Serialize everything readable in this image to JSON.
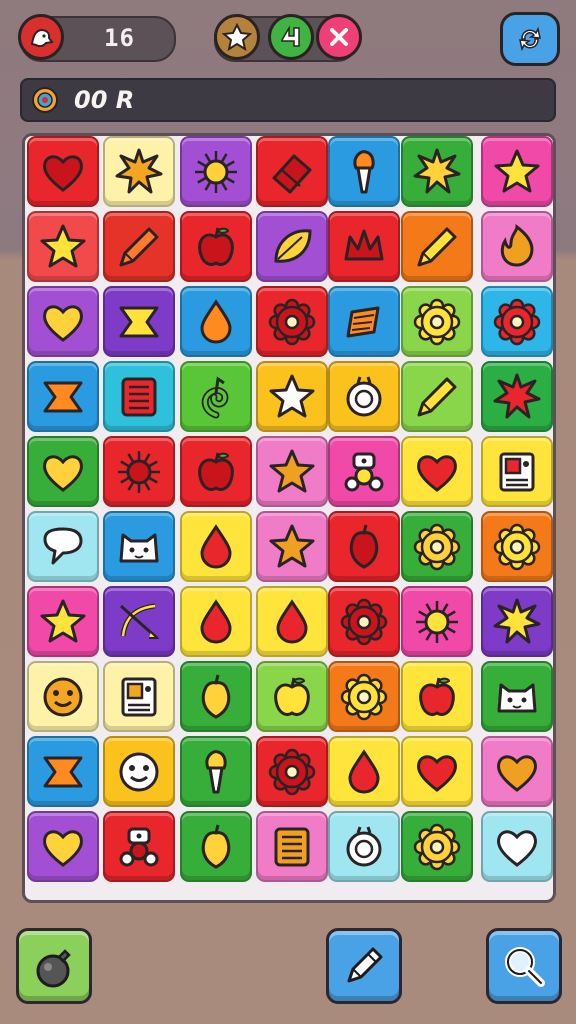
{
  "hud": {
    "score": "16",
    "info_text": "00 R",
    "icons": [
      "level-badge-icon",
      "star-coin-icon",
      "boost-icon",
      "close-icon",
      "refresh-icon"
    ]
  },
  "board": {
    "cols": 7,
    "rows": 10,
    "tiles": [
      [
        {
          "c": "#e8262b",
          "i": "heart"
        },
        {
          "c": "#fdf2a8",
          "i": "burst"
        },
        {
          "c": "#a24fd4",
          "i": "sun"
        },
        {
          "c": "#e8262b",
          "i": "eraser"
        },
        {
          "c": "#2a9be0",
          "i": "torch"
        },
        {
          "c": "#37ad3a",
          "i": "burst"
        },
        {
          "c": "#f049a8",
          "i": "star"
        }
      ],
      [
        {
          "c": "#f2494a",
          "i": "star"
        },
        {
          "c": "#e5332a",
          "i": "pencil"
        },
        {
          "c": "#e8262b",
          "i": "apple"
        },
        {
          "c": "#a24fd4",
          "i": "leaf"
        },
        {
          "c": "#e8262b",
          "i": "crown"
        },
        {
          "c": "#f47a19",
          "i": "pencil"
        },
        {
          "c": "#f07bc6",
          "i": "flame"
        }
      ],
      [
        {
          "c": "#a24fd4",
          "i": "heart"
        },
        {
          "c": "#7d3bc7",
          "i": "flag"
        },
        {
          "c": "#2a9be0",
          "i": "drop"
        },
        {
          "c": "#e8262b",
          "i": "gear"
        },
        {
          "c": "#2a9be0",
          "i": "note"
        },
        {
          "c": "#8ad64a",
          "i": "gear"
        },
        {
          "c": "#2fb6e8",
          "i": "gear"
        }
      ],
      [
        {
          "c": "#2a9be0",
          "i": "flag"
        },
        {
          "c": "#2fc1dc",
          "i": "box"
        },
        {
          "c": "#59c637",
          "i": "swirl"
        },
        {
          "c": "#fbc21e",
          "i": "star"
        },
        {
          "c": "#fbc21e",
          "i": "ring"
        },
        {
          "c": "#8ad64a",
          "i": "pencil"
        },
        {
          "c": "#2bae44",
          "i": "burst"
        }
      ],
      [
        {
          "c": "#37ad3a",
          "i": "heart"
        },
        {
          "c": "#e8262b",
          "i": "sun"
        },
        {
          "c": "#e8262b",
          "i": "apple"
        },
        {
          "c": "#f07bc6",
          "i": "star"
        },
        {
          "c": "#f049a8",
          "i": "robot"
        },
        {
          "c": "#ffe53b",
          "i": "heart"
        },
        {
          "c": "#ffe53b",
          "i": "machine"
        }
      ],
      [
        {
          "c": "#9fe6f0",
          "i": "bubble"
        },
        {
          "c": "#2a9be0",
          "i": "cat"
        },
        {
          "c": "#ffe53b",
          "i": "drop"
        },
        {
          "c": "#f07bc6",
          "i": "star"
        },
        {
          "c": "#e8262b",
          "i": "fruit"
        },
        {
          "c": "#37ad3a",
          "i": "gear"
        },
        {
          "c": "#f47a19",
          "i": "gear"
        }
      ],
      [
        {
          "c": "#f049a8",
          "i": "star"
        },
        {
          "c": "#7d3bc7",
          "i": "bow"
        },
        {
          "c": "#ffe53b",
          "i": "drop"
        },
        {
          "c": "#ffe53b",
          "i": "drop"
        },
        {
          "c": "#e8262b",
          "i": "gear"
        },
        {
          "c": "#f049a8",
          "i": "sun"
        },
        {
          "c": "#7d3bc7",
          "i": "burst"
        }
      ],
      [
        {
          "c": "#fdf2a8",
          "i": "face"
        },
        {
          "c": "#fdf2a8",
          "i": "machine"
        },
        {
          "c": "#37ad3a",
          "i": "fruit"
        },
        {
          "c": "#8ad64a",
          "i": "apple"
        },
        {
          "c": "#f47a19",
          "i": "gear"
        },
        {
          "c": "#ffe53b",
          "i": "apple"
        },
        {
          "c": "#37ad3a",
          "i": "cat"
        }
      ],
      [
        {
          "c": "#2a9be0",
          "i": "flag"
        },
        {
          "c": "#fbc21e",
          "i": "face"
        },
        {
          "c": "#37ad3a",
          "i": "torch"
        },
        {
          "c": "#e8262b",
          "i": "gear"
        },
        {
          "c": "#ffe53b",
          "i": "drop"
        },
        {
          "c": "#ffe53b",
          "i": "heart"
        },
        {
          "c": "#f07bc6",
          "i": "heart"
        }
      ],
      [
        {
          "c": "#a24fd4",
          "i": "heart"
        },
        {
          "c": "#e8262b",
          "i": "robot"
        },
        {
          "c": "#37ad3a",
          "i": "fruit"
        },
        {
          "c": "#f07bc6",
          "i": "box"
        },
        {
          "c": "#9fe6f0",
          "i": "ring"
        },
        {
          "c": "#37ad3a",
          "i": "gear"
        },
        {
          "c": "#9fe6f0",
          "i": "heart"
        }
      ]
    ]
  },
  "bottom_buttons": [
    {
      "name": "bomb-button",
      "icon": "bomb-icon",
      "color": "#8ad05a"
    },
    {
      "name": "pencil-button",
      "icon": "pencil-icon",
      "color": "#4aa2e6"
    },
    {
      "name": "search-button",
      "icon": "search-icon",
      "color": "#4aa2e6"
    }
  ]
}
